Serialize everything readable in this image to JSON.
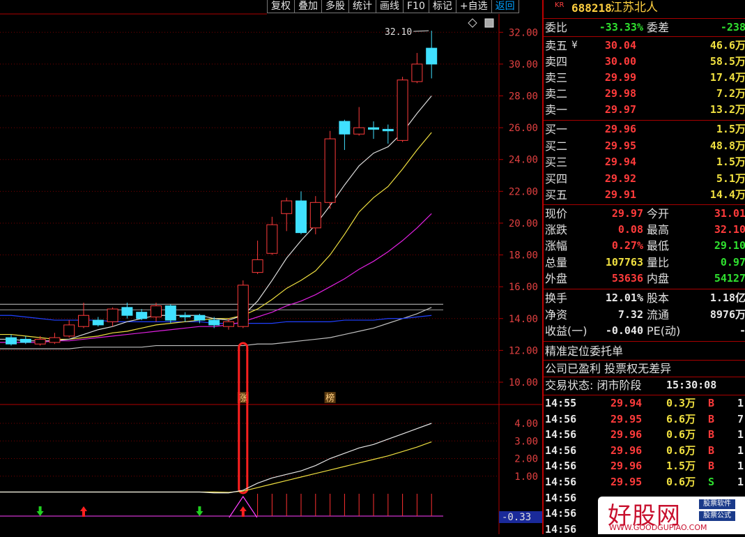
{
  "toolbar": [
    "复权",
    "叠加",
    "多股",
    "统计",
    "画线",
    "F10",
    "标记",
    "+自选",
    "返回"
  ],
  "colors": {
    "up": "#ff3b3b",
    "down": "#40e0ff",
    "border": "#b00000",
    "ma5": "#dcdcdc",
    "ma10": "#f0e040",
    "ma20": "#e020e0",
    "ma60": "#2040ff",
    "ma120": "#c0c0c0"
  },
  "chart_data": {
    "type": "candlestick",
    "ylim": [
      9.5,
      32.8
    ],
    "yticks": [
      "32.00",
      "30.00",
      "28.00",
      "26.00",
      "24.00",
      "22.00",
      "20.00",
      "18.00",
      "16.00",
      "14.00",
      "12.00",
      "10.00"
    ],
    "high_label": "32.10",
    "candles": [
      {
        "o": 12.8,
        "c": 12.4,
        "h": 13.0,
        "l": 12.3
      },
      {
        "o": 12.7,
        "c": 12.5,
        "h": 12.9,
        "l": 12.4
      },
      {
        "o": 12.4,
        "c": 12.7,
        "h": 12.9,
        "l": 12.3
      },
      {
        "o": 12.5,
        "c": 12.8,
        "h": 13.1,
        "l": 12.4
      },
      {
        "o": 12.9,
        "c": 13.6,
        "h": 13.9,
        "l": 12.8
      },
      {
        "o": 13.5,
        "c": 14.2,
        "h": 15.0,
        "l": 13.4
      },
      {
        "o": 13.9,
        "c": 13.6,
        "h": 14.1,
        "l": 13.5
      },
      {
        "o": 13.8,
        "c": 14.6,
        "h": 14.7,
        "l": 13.5
      },
      {
        "o": 14.7,
        "c": 14.2,
        "h": 15.0,
        "l": 14.0
      },
      {
        "o": 14.4,
        "c": 14.0,
        "h": 14.6,
        "l": 13.9
      },
      {
        "o": 14.1,
        "c": 14.8,
        "h": 15.0,
        "l": 13.8
      },
      {
        "o": 14.8,
        "c": 13.9,
        "h": 14.9,
        "l": 13.7
      },
      {
        "o": 14.2,
        "c": 14.1,
        "h": 14.4,
        "l": 13.8
      },
      {
        "o": 14.2,
        "c": 13.9,
        "h": 14.3,
        "l": 13.7
      },
      {
        "o": 13.9,
        "c": 13.6,
        "h": 14.1,
        "l": 13.4
      },
      {
        "o": 13.5,
        "c": 13.8,
        "h": 14.0,
        "l": 13.3
      },
      {
        "o": 13.5,
        "c": 16.1,
        "h": 16.4,
        "l": 13.4
      },
      {
        "o": 16.9,
        "c": 17.7,
        "h": 18.9,
        "l": 16.8
      },
      {
        "o": 18.1,
        "c": 19.9,
        "h": 20.4,
        "l": 18.0
      },
      {
        "o": 20.6,
        "c": 21.4,
        "h": 21.6,
        "l": 19.5
      },
      {
        "o": 21.4,
        "c": 19.4,
        "h": 22.0,
        "l": 19.3
      },
      {
        "o": 19.7,
        "c": 21.3,
        "h": 21.7,
        "l": 19.3
      },
      {
        "o": 21.3,
        "c": 25.3,
        "h": 25.8,
        "l": 20.9
      },
      {
        "o": 26.4,
        "c": 25.6,
        "h": 26.5,
        "l": 24.6
      },
      {
        "o": 25.6,
        "c": 26.0,
        "h": 27.3,
        "l": 25.5
      },
      {
        "o": 26.0,
        "c": 25.9,
        "h": 26.4,
        "l": 25.3
      },
      {
        "o": 25.9,
        "c": 25.8,
        "h": 26.2,
        "l": 25.0
      },
      {
        "o": 25.2,
        "c": 29.0,
        "h": 29.2,
        "l": 25.1
      },
      {
        "o": 28.9,
        "c": 30.0,
        "h": 30.7,
        "l": 28.8
      },
      {
        "o": 31.0,
        "c": 30.0,
        "h": 32.1,
        "l": 29.1
      }
    ],
    "ma5": [
      12.7,
      12.6,
      12.6,
      12.6,
      12.7,
      13.0,
      13.3,
      13.5,
      13.8,
      14.0,
      14.2,
      14.2,
      14.2,
      14.2,
      14.0,
      13.9,
      14.2,
      15.1,
      16.4,
      17.8,
      18.9,
      19.9,
      21.1,
      22.4,
      23.6,
      24.4,
      24.8,
      25.7,
      26.9,
      28.0
    ],
    "ma10": [
      13.0,
      12.9,
      12.8,
      12.7,
      12.7,
      12.8,
      12.9,
      13.1,
      13.2,
      13.4,
      13.6,
      13.7,
      13.8,
      13.9,
      14.0,
      14.0,
      14.2,
      14.6,
      15.2,
      15.9,
      16.4,
      17.0,
      18.0,
      19.3,
      20.7,
      21.6,
      22.3,
      23.4,
      24.6,
      25.7
    ],
    "ma20": [
      12.5,
      12.5,
      12.5,
      12.6,
      12.6,
      12.7,
      12.8,
      12.9,
      13.0,
      13.1,
      13.2,
      13.3,
      13.4,
      13.5,
      13.5,
      13.6,
      13.8,
      14.1,
      14.4,
      14.8,
      15.1,
      15.5,
      16.0,
      16.5,
      17.1,
      17.6,
      18.2,
      18.9,
      19.7,
      20.6
    ],
    "ma60": [
      14.2,
      14.1,
      14.0,
      13.9,
      13.9,
      13.9,
      13.9,
      13.8,
      13.8,
      13.8,
      13.8,
      13.8,
      13.8,
      13.8,
      13.7,
      13.7,
      13.7,
      13.7,
      13.7,
      13.8,
      13.8,
      13.8,
      13.8,
      13.9,
      13.9,
      13.9,
      14.0,
      14.0,
      14.1,
      14.2
    ],
    "ma120": [
      12.1,
      12.1,
      12.1,
      12.1,
      12.1,
      12.2,
      12.2,
      12.2,
      12.2,
      12.2,
      12.3,
      12.3,
      12.3,
      12.3,
      12.3,
      12.3,
      12.3,
      12.4,
      12.4,
      12.5,
      12.6,
      12.7,
      12.8,
      13.0,
      13.2,
      13.4,
      13.7,
      14.0,
      14.3,
      14.7
    ],
    "flat_lines": [
      14.9,
      14.55
    ],
    "markers": [
      {
        "index": 16,
        "text": "涨"
      },
      {
        "index": 22,
        "text": "榜"
      }
    ],
    "indicator": {
      "ylim": [
        0,
        4.6
      ],
      "yticks": [
        "4.00",
        "3.00",
        "2.00",
        "1.00"
      ],
      "current_label": "-0.33",
      "white": [
        0.1,
        0.1,
        0.1,
        0.1,
        0.1,
        0.1,
        0.1,
        0.1,
        0.1,
        0.1,
        0.1,
        0.1,
        0.1,
        0.1,
        0.05,
        0.05,
        0.2,
        0.6,
        0.9,
        1.1,
        1.3,
        1.6,
        2.0,
        2.3,
        2.6,
        2.8,
        3.1,
        3.4,
        3.7,
        4.0
      ],
      "yellow": [
        0.1,
        0.1,
        0.1,
        0.1,
        0.1,
        0.1,
        0.1,
        0.1,
        0.1,
        0.1,
        0.1,
        0.1,
        0.1,
        0.1,
        0.1,
        0.08,
        0.15,
        0.35,
        0.55,
        0.75,
        0.95,
        1.15,
        1.35,
        1.55,
        1.75,
        1.95,
        2.15,
        2.4,
        2.65,
        2.95
      ],
      "green_arrows": [
        2,
        13
      ],
      "red_arrows": [
        5,
        16
      ]
    }
  },
  "quote": {
    "code_prefix": "KR",
    "code": "688218",
    "name": "江苏北人",
    "weibi_label": "委比",
    "weibi": "-33.33%",
    "weicha_label": "委差",
    "weicha": "-238",
    "sells": [
      {
        "label": "卖五",
        "price": "30.04",
        "vol": "46.6万"
      },
      {
        "label": "卖四",
        "price": "30.00",
        "vol": "58.5万"
      },
      {
        "label": "卖三",
        "price": "29.99",
        "vol": "17.4万"
      },
      {
        "label": "卖二",
        "price": "29.98",
        "vol": "7.2万"
      },
      {
        "label": "卖一",
        "price": "29.97",
        "vol": "13.2万"
      }
    ],
    "sell5_mark": "¥",
    "buys": [
      {
        "label": "买一",
        "price": "29.96",
        "vol": "1.5万"
      },
      {
        "label": "买二",
        "price": "29.95",
        "vol": "48.8万"
      },
      {
        "label": "买三",
        "price": "29.94",
        "vol": "1.5万"
      },
      {
        "label": "买四",
        "price": "29.92",
        "vol": "5.1万"
      },
      {
        "label": "买五",
        "price": "29.91",
        "vol": "14.4万"
      }
    ],
    "stats": [
      {
        "l1": "现价",
        "v1": "29.97",
        "c1": "red",
        "l2": "今开",
        "v2": "31.01",
        "c2": "red"
      },
      {
        "l1": "涨跌",
        "v1": "0.08",
        "c1": "red",
        "l2": "最高",
        "v2": "32.10",
        "c2": "red"
      },
      {
        "l1": "涨幅",
        "v1": "0.27%",
        "c1": "red",
        "l2": "最低",
        "v2": "29.10",
        "c2": "green"
      },
      {
        "l1": "总量",
        "v1": "107763",
        "c1": "yellow",
        "l2": "量比",
        "v2": "0.97",
        "c2": "green"
      },
      {
        "l1": "外盘",
        "v1": "53636",
        "c1": "red",
        "l2": "内盘",
        "v2": "54127",
        "c2": "green"
      }
    ],
    "stats2": [
      {
        "l1": "换手",
        "v1": "12.01%",
        "l2": "股本",
        "v2": "1.18亿"
      },
      {
        "l1": "净资",
        "v1": "7.32",
        "l2": "流通",
        "v2": "8976万"
      },
      {
        "l1": "收益(一)",
        "v1": "-0.040",
        "l2": "PE(动)",
        "v2": "-"
      }
    ],
    "info1": "精准定位委托单",
    "info2": "公司已盈利 投票权无差异",
    "trade_status_label": "交易状态: 闭市阶段",
    "trade_status_time": "15:30:08",
    "ticks": [
      {
        "t": "14:55",
        "p": "29.94",
        "v": "0.3万",
        "s": "B",
        "n": "1"
      },
      {
        "t": "14:56",
        "p": "29.95",
        "v": "6.6万",
        "s": "B",
        "n": "7"
      },
      {
        "t": "14:56",
        "p": "29.96",
        "v": "0.6万",
        "s": "B",
        "n": "1"
      },
      {
        "t": "14:56",
        "p": "29.96",
        "v": "0.6万",
        "s": "B",
        "n": "1"
      },
      {
        "t": "14:56",
        "p": "29.96",
        "v": "1.5万",
        "s": "B",
        "n": "1"
      },
      {
        "t": "14:56",
        "p": "29.95",
        "v": "0.6万",
        "s": "S",
        "n": "1"
      },
      {
        "t": "14:56",
        "p": "",
        "v": "",
        "s": "",
        "n": ""
      },
      {
        "t": "14:56",
        "p": "",
        "v": "",
        "s": "",
        "n": ""
      },
      {
        "t": "14:56",
        "p": "",
        "v": "",
        "s": "",
        "n": ""
      }
    ]
  },
  "watermark": {
    "main": "好股网",
    "url": "WWW.GOODGUPIAO.COM",
    "tag1": "股票软件",
    "tag2": "股票公式"
  }
}
